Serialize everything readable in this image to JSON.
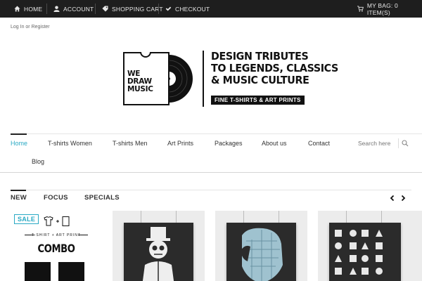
{
  "topbar": {
    "home": "HOME",
    "account": "ACCOUNT",
    "cart": "SHOPPING CART",
    "checkout": "CHECKOUT",
    "bag": "MY BAG: 0 ITEM(S)"
  },
  "header": {
    "login": "Log In or Register"
  },
  "logo": {
    "tee_text": [
      "WE",
      "DRAW",
      "MUSIC"
    ],
    "tagline": [
      "DESIGN TRIBUTES",
      "TO LEGENDS, CLASSICS",
      "& MUSIC CULTURE"
    ],
    "subtitle": "FINE T-SHIRTS & ART PRINTS"
  },
  "nav": {
    "items": [
      "Home",
      "T-shirts Women",
      "T-shirts Men",
      "Art Prints",
      "Packages",
      "About us",
      "Contact",
      "Blog"
    ],
    "active": "Home"
  },
  "search": {
    "placeholder": "Search here"
  },
  "product_tabs": [
    "NEW",
    "FOCUS",
    "SPECIALS"
  ],
  "combo": {
    "badge": "SALE",
    "small": "T-SHIRT + ART PRINT",
    "title": "COMBO"
  },
  "colors": {
    "topbar": "#1e1e1e",
    "accent": "#29a9c4",
    "text": "#333333"
  },
  "icons": [
    "home-icon",
    "user-icon",
    "tag-icon",
    "check-icon",
    "cart-icon",
    "search-icon",
    "chevron-left-icon",
    "chevron-right-icon"
  ]
}
